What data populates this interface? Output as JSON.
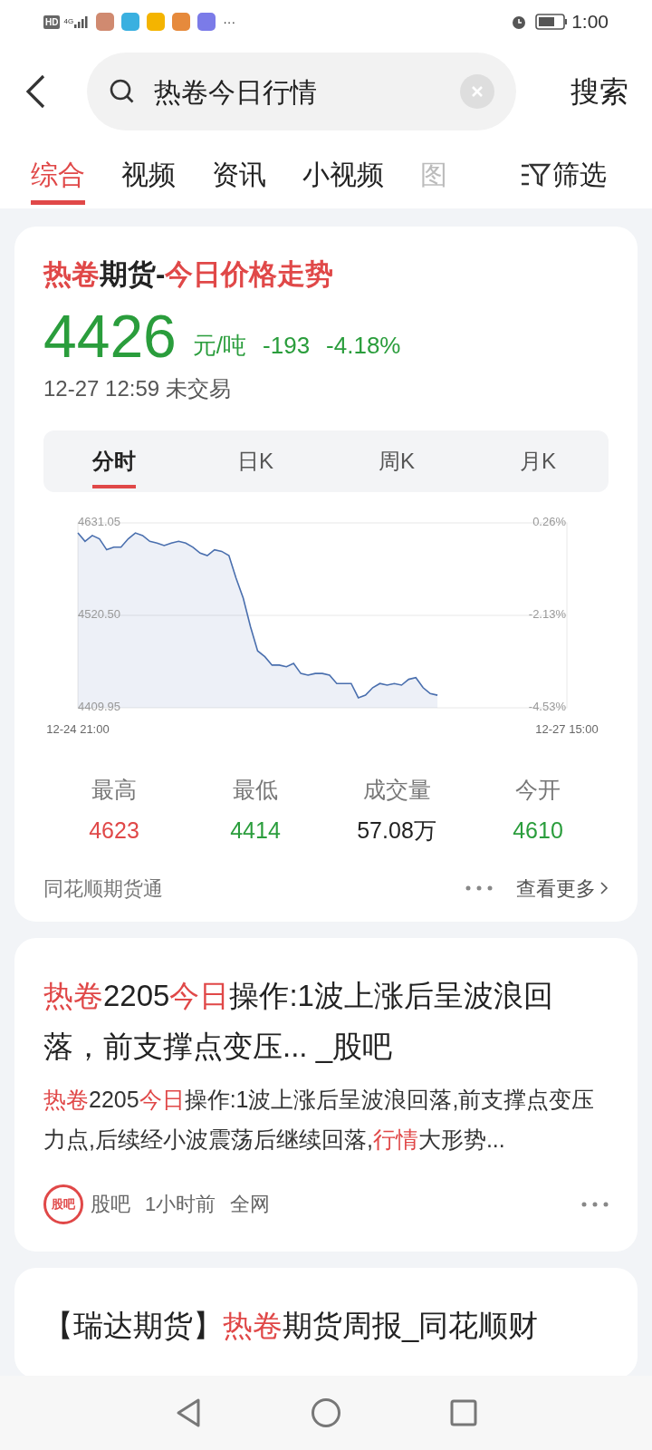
{
  "status_bar": {
    "hd": "HD",
    "time": "1:00",
    "network": "4G",
    "more": "···"
  },
  "search": {
    "value": "热卷今日行情",
    "submit": "搜索"
  },
  "tabs": [
    {
      "label": "综合",
      "selected": true
    },
    {
      "label": "视频",
      "selected": false
    },
    {
      "label": "资讯",
      "selected": false
    },
    {
      "label": "小视频",
      "selected": false
    },
    {
      "label": "图",
      "selected": false
    }
  ],
  "filter": "筛选",
  "quote_card": {
    "title": [
      {
        "text": "热卷",
        "highlight": true
      },
      {
        "text": "期货-",
        "highlight": false
      },
      {
        "text": "今日价格走势",
        "highlight": true
      }
    ],
    "price": "4426",
    "unit": "元/吨",
    "change": "-193",
    "change_pct": "-4.18%",
    "time": "12-27 12:59 未交易",
    "periods": [
      {
        "label": "分时",
        "selected": true
      },
      {
        "label": "日K",
        "selected": false
      },
      {
        "label": "周K",
        "selected": false
      },
      {
        "label": "月K",
        "selected": false
      }
    ],
    "chart_data": {
      "type": "area",
      "categories": [
        "12-24 21:00",
        null,
        null,
        null,
        null,
        null,
        null,
        null,
        null,
        null,
        null,
        null,
        null,
        null,
        null,
        null,
        null,
        null,
        null,
        null,
        null,
        null,
        null,
        null,
        null,
        null,
        null,
        null,
        null,
        null,
        null,
        null,
        null,
        null,
        null,
        null,
        null,
        null,
        null,
        null,
        null,
        null,
        null,
        null,
        null,
        null,
        null,
        null,
        null,
        null,
        null,
        null,
        null,
        null,
        null,
        null,
        null,
        null,
        null,
        null,
        null,
        null,
        null,
        null,
        null,
        null,
        null,
        null,
        "12-27 15:00"
      ],
      "ylim": [
        4409.95,
        4631.05
      ],
      "yticks": [
        {
          "value": 4409.95,
          "label": "4409.95"
        },
        {
          "value": 4520.5,
          "label": "4520.50"
        },
        {
          "value": 4631.05,
          "label": "4631.05"
        }
      ],
      "series": [
        {
          "color": "#4a6fae",
          "values": [
            4619,
            4609,
            4616,
            4612,
            4599,
            4602,
            4602,
            4612,
            4619,
            4616,
            4609,
            4607,
            4604,
            4607,
            4609,
            4607,
            4602,
            4595,
            4592,
            4599,
            4597,
            4592,
            4565,
            4541,
            4507,
            4478,
            4471,
            4461,
            4461,
            4459,
            4463,
            4451,
            4449,
            4451,
            4451,
            4449,
            4439,
            4439,
            4439,
            4422,
            4425,
            4434,
            4439,
            4437,
            4439,
            4437,
            4444,
            4446,
            4434,
            4427,
            4425,
            null,
            null,
            null,
            null,
            null,
            null,
            null,
            null,
            null,
            null,
            null,
            null,
            null,
            null,
            null,
            null,
            null,
            null
          ]
        }
      ]
    },
    "percent_ticks": [
      "0.26%",
      "-2.13%",
      "-4.53%"
    ],
    "stats": [
      {
        "label": "最高",
        "value": "4623",
        "color": "#e04848"
      },
      {
        "label": "最低",
        "value": "4414",
        "color": "#2a9d3c"
      },
      {
        "label": "成交量",
        "value": "57.08万",
        "color": "#222222"
      },
      {
        "label": "今开",
        "value": "4610",
        "color": "#2a9d3c"
      }
    ],
    "source": "同花顺期货通",
    "more_link": "查看更多"
  },
  "articles": [
    {
      "title": [
        {
          "text": "热卷",
          "highlight": true
        },
        {
          "text": "2205",
          "highlight": false
        },
        {
          "text": "今日",
          "highlight": true
        },
        {
          "text": "操作:1波上涨后呈波浪回落，前支撑点变压... _股吧",
          "highlight": false
        }
      ],
      "snippet": [
        {
          "text": "热卷",
          "highlight": true
        },
        {
          "text": "2205",
          "highlight": false
        },
        {
          "text": "今日",
          "highlight": true
        },
        {
          "text": "操作:1波上涨后呈波浪回落,前支撑点变压力点,后续经小波震荡后继续回落,",
          "highlight": false
        },
        {
          "text": "行情",
          "highlight": true
        },
        {
          "text": "大形势...",
          "highlight": false
        }
      ],
      "logo": "股吧",
      "source": "股吧",
      "time": "1小时前",
      "scope": "全网"
    },
    {
      "title": [
        {
          "text": "【瑞达期货】",
          "highlight": false
        },
        {
          "text": "热卷",
          "highlight": true
        },
        {
          "text": "期货周报_同花顺财",
          "highlight": false
        }
      ]
    }
  ]
}
